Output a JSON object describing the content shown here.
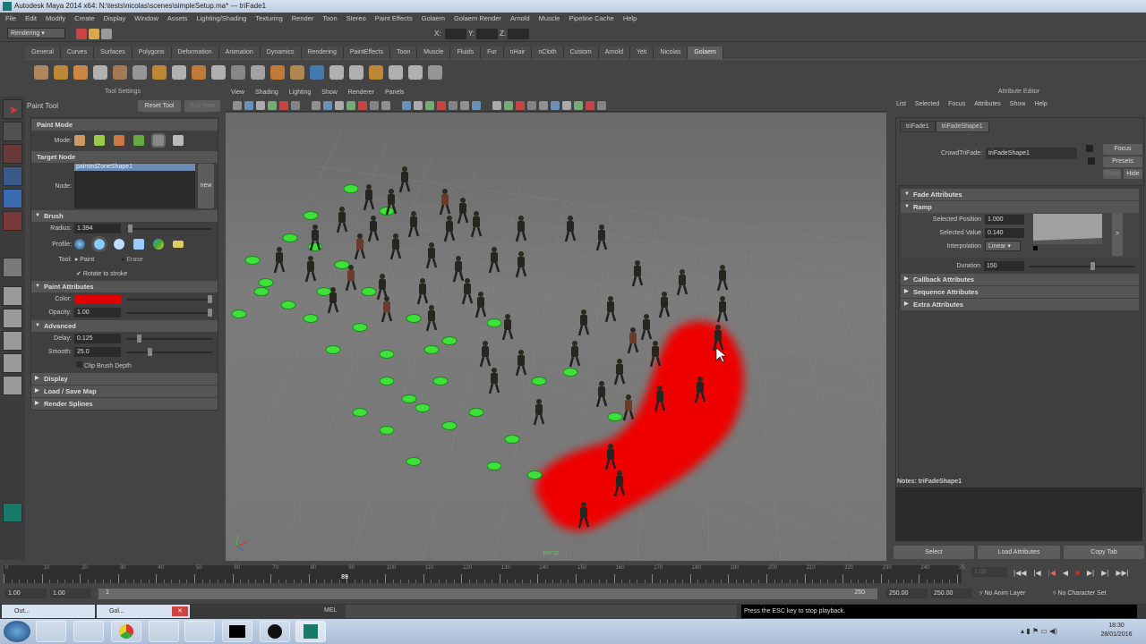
{
  "window": {
    "title": "Autodesk Maya 2014 x64: N:\\tests\\nicolas\\scenes\\simpleSetup.ma*   ---   triFade1"
  },
  "menus": [
    "File",
    "Edit",
    "Modify",
    "Create",
    "Display",
    "Window",
    "Assets",
    "Lighting/Shading",
    "Texturing",
    "Render",
    "Toon",
    "Stereo",
    "Paint Effects",
    "Golaem",
    "Golaem Render",
    "Arnold",
    "Muscle",
    "Pipeline Cache",
    "Help"
  ],
  "status": {
    "mode": "Rendering",
    "x_label": "X:",
    "y_label": "Y:",
    "z_label": "Z:"
  },
  "shelf_tabs": [
    "General",
    "Curves",
    "Surfaces",
    "Polygons",
    "Deformation",
    "Animation",
    "Dynamics",
    "Rendering",
    "PaintEffects",
    "Toon",
    "Muscle",
    "Fluids",
    "Fur",
    "nHair",
    "nCloth",
    "Custom",
    "Arnold",
    "Yeti",
    "Nicolas",
    "Golaem"
  ],
  "shelf_active": "Golaem",
  "tool_settings": {
    "panel_title": "Tool Settings",
    "tool_name": "Paint Tool",
    "reset": "Reset Tool",
    "help": "Tool Help",
    "paint_mode": "Paint Mode",
    "mode_label": "Mode:",
    "target_node": "Target Node",
    "node_label": "Node:",
    "node_value": "paintedZoneShape1",
    "new": "new",
    "brush": "Brush",
    "radius_label": "Radius:",
    "radius": "1.394",
    "profile_label": "Profile:",
    "tool_label": "Tool:",
    "paint": "Paint",
    "erase": "Erase",
    "rotate": "Rotate to stroke",
    "paint_attributes": "Paint Attributes",
    "color_label": "Color:",
    "color": "#e00000",
    "opacity_label": "Opacity:",
    "opacity": "1.00",
    "advanced": "Advanced",
    "delay_label": "Delay:",
    "delay": "0.125",
    "smooth_label": "Smooth:",
    "smooth": "25.0",
    "clip": "Clip Brush Depth",
    "display": "Display",
    "load_save": "Load / Save Map",
    "render_splines": "Render Splines"
  },
  "viewport": {
    "menus": [
      "View",
      "Shading",
      "Lighting",
      "Show",
      "Renderer",
      "Panels"
    ],
    "camera": "persp"
  },
  "attr": {
    "title": "Attribute Editor",
    "menus": [
      "List",
      "Selected",
      "Focus",
      "Attributes",
      "Show",
      "Help"
    ],
    "tabs": [
      "triFade1",
      "triFadeShape1"
    ],
    "node_label": "CrowdTriFade:",
    "node_value": "triFadeShape1",
    "focus": "Focus",
    "presets": "Presets",
    "show": "Show",
    "hide": "Hide",
    "fade": "Fade Attributes",
    "ramp": "Ramp",
    "sel_pos_label": "Selected Position",
    "sel_pos": "1.000",
    "sel_val_label": "Selected Value",
    "sel_val": "0.140",
    "interp_label": "Interpolation",
    "interp": "Linear",
    "ramp_btn": ">",
    "duration_label": "Duration",
    "duration": "150",
    "callback": "Callback Attributes",
    "sequence": "Sequence Attributes",
    "extra": "Extra Attributes",
    "notes": "Notes: triFadeShape1",
    "select": "Select",
    "load": "Load Attributes",
    "copy": "Copy Tab"
  },
  "timeline": {
    "ticks": [
      "0",
      "10",
      "20",
      "30",
      "40",
      "50",
      "60",
      "70",
      "80",
      "90",
      "100",
      "110",
      "120",
      "130",
      "140",
      "150",
      "160",
      "170",
      "180",
      "190",
      "200",
      "210",
      "220",
      "230",
      "240",
      "25"
    ],
    "current": "89",
    "frame_field": "1.00",
    "start": "1.00",
    "start2": "1.00",
    "range_start": "1",
    "range_end": "250",
    "end": "250.00",
    "end2": "250.00",
    "anim_layer": "No Anim Layer",
    "char_set": "No Character Set"
  },
  "cmdline": {
    "win1": "Out...",
    "win2": "Gol...",
    "mel": "MEL",
    "message": "Press the ESC key to stop playback."
  },
  "taskbar": {
    "time": "18:30",
    "date": "28/01/2016"
  }
}
